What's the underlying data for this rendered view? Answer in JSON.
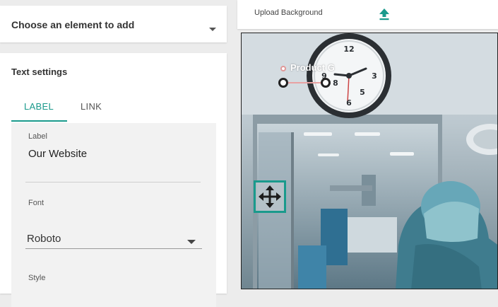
{
  "element_chooser": {
    "placeholder": "Choose an element to add"
  },
  "text_settings": {
    "title": "Text settings",
    "tabs": [
      {
        "label": "LABEL",
        "active": true
      },
      {
        "label": "LINK",
        "active": false
      }
    ],
    "label_field": {
      "caption": "Label",
      "value": "Our Website"
    },
    "font_field": {
      "caption": "Font",
      "value": "Roboto"
    },
    "style_field": {
      "caption": "Style"
    }
  },
  "upload": {
    "label": "Upload Background",
    "icon": "upload-arrow-icon"
  },
  "canvas": {
    "element_text": "Product G",
    "move_icon": "move-arrows-icon"
  },
  "colors": {
    "accent": "#1a9a8c",
    "canvas_border": "#222222"
  }
}
